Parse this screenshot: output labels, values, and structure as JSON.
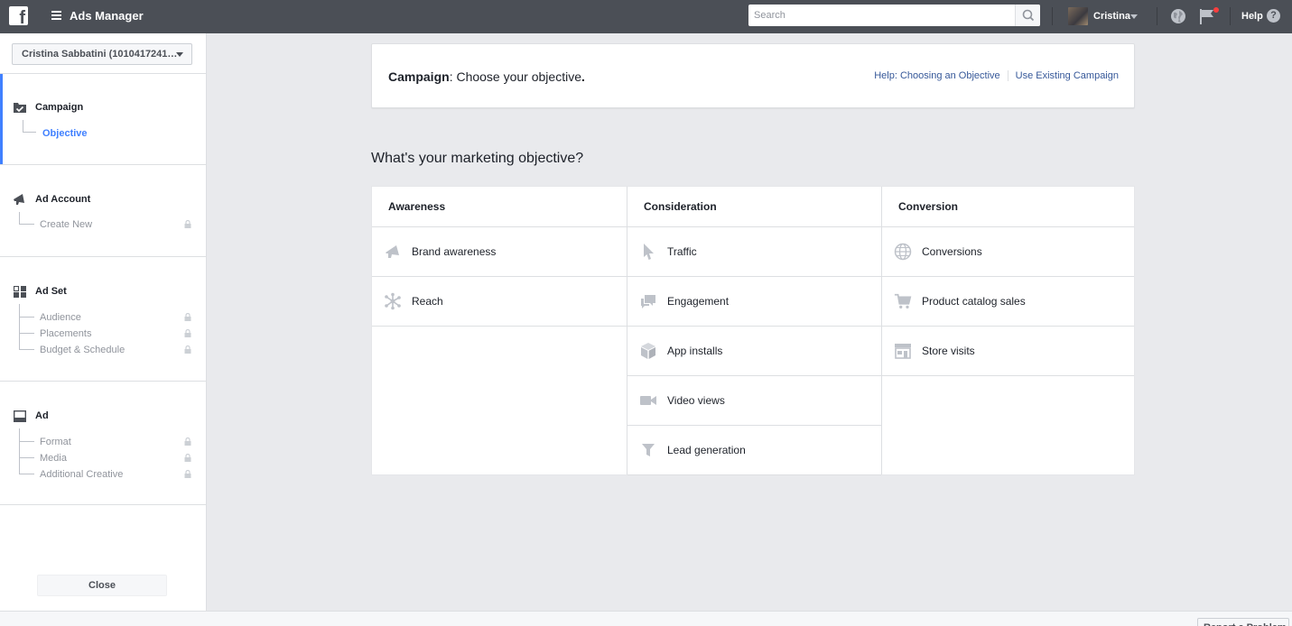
{
  "topbar": {
    "app_title": "Ads Manager",
    "search_placeholder": "Search",
    "user_name": "Cristina",
    "help_label": "Help",
    "help_glyph": "?"
  },
  "sidebar": {
    "account": "Cristina Sabbatini (1010417241…",
    "sections": [
      {
        "label": "Campaign",
        "icon": "campaign-check-icon",
        "items": [
          {
            "label": "Objective",
            "active": true,
            "locked": false
          }
        ]
      },
      {
        "label": "Ad Account",
        "icon": "megaphone-icon",
        "items": [
          {
            "label": "Create New",
            "locked": true
          }
        ]
      },
      {
        "label": "Ad Set",
        "icon": "grid-icon",
        "items": [
          {
            "label": "Audience",
            "locked": true
          },
          {
            "label": "Placements",
            "locked": true
          },
          {
            "label": "Budget & Schedule",
            "locked": true
          }
        ]
      },
      {
        "label": "Ad",
        "icon": "ad-window-icon",
        "items": [
          {
            "label": "Format",
            "locked": true
          },
          {
            "label": "Media",
            "locked": true
          },
          {
            "label": "Additional Creative",
            "locked": true
          }
        ]
      }
    ],
    "close_label": "Close"
  },
  "header": {
    "title_bold": "Campaign",
    "title_rest": ": Choose your objective",
    "title_period": ".",
    "help_link": "Help: Choosing an Objective",
    "existing_link": "Use Existing Campaign"
  },
  "question": "What's your marketing objective?",
  "objectives": {
    "columns": [
      {
        "heading": "Awareness",
        "items": [
          {
            "label": "Brand awareness",
            "icon": "megaphone-icon"
          },
          {
            "label": "Reach",
            "icon": "reach-icon"
          }
        ]
      },
      {
        "heading": "Consideration",
        "items": [
          {
            "label": "Traffic",
            "icon": "cursor-icon"
          },
          {
            "label": "Engagement",
            "icon": "chat-bubbles-icon"
          },
          {
            "label": "App installs",
            "icon": "box-icon"
          },
          {
            "label": "Video views",
            "icon": "video-camera-icon"
          },
          {
            "label": "Lead generation",
            "icon": "funnel-icon"
          }
        ]
      },
      {
        "heading": "Conversion",
        "items": [
          {
            "label": "Conversions",
            "icon": "globe-icon"
          },
          {
            "label": "Product catalog sales",
            "icon": "cart-icon"
          },
          {
            "label": "Store visits",
            "icon": "store-icon"
          }
        ]
      }
    ]
  },
  "footer": {
    "button_label": "Report a Problem"
  },
  "colors": {
    "topbar": "#4b4f56",
    "accent": "#4080ff",
    "link": "#365899",
    "icon_gray": "#bec2c9",
    "notification": "#fa3e3e"
  }
}
